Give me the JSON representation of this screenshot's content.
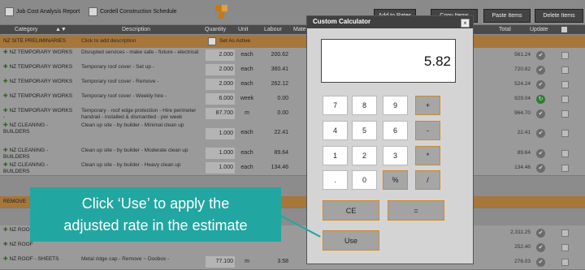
{
  "toolbar": {
    "job_report": "Job Cost Analysis Report",
    "schedule": "Cordell Construction Schedule",
    "btn_add_rates": "Add to Rates",
    "btn_copy_items": "Copy Items",
    "btn_paste_items": "Paste Items",
    "btn_delete_items": "Delete Items"
  },
  "grid": {
    "headers": {
      "category": "Category",
      "description": "Description",
      "quantity": "Quantity",
      "unit": "Unit",
      "labour": "Labour",
      "mate": "Mate",
      "total": "Total",
      "update": "Update"
    },
    "sections": [
      {
        "label": "NZ SITE PRELIMINARIES",
        "note": "Click to add description",
        "flag": "Set As Active"
      },
      {
        "label": "REMOVE"
      }
    ],
    "rows": [
      {
        "category": "NZ TEMPORARY WORKS",
        "description": "Disrupted services - make safe - fixture - electrical",
        "quantity": "2.000",
        "unit": "each",
        "labour": "200.62",
        "total": "561.24",
        "status": "check"
      },
      {
        "category": "NZ TEMPORARY WORKS",
        "description": "Temporary roof cover - Set up -",
        "quantity": "2.000",
        "unit": "each",
        "labour": "360.41",
        "total": "720.82",
        "status": "check"
      },
      {
        "category": "NZ TEMPORARY WORKS",
        "description": "Temporary roof cover - Remove -",
        "quantity": "2.000",
        "unit": "each",
        "labour": "262.12",
        "total": "524.24",
        "status": "check"
      },
      {
        "category": "NZ TEMPORARY WORKS",
        "description": "Temporary roof cover - Weekly hire -",
        "quantity": "6.000",
        "unit": "week",
        "labour": "0.00",
        "total": "929.04",
        "status": "refresh"
      },
      {
        "category": "NZ TEMPORARY WORKS -",
        "description": "Temporary - roof edge protection - Hire perimeter handrail - installed & dismantled - per week",
        "quantity": "87.700",
        "unit": "m",
        "labour": "0.00",
        "total": "964.70",
        "status": "check"
      },
      {
        "category": "NZ CLEANING - BUILDERS",
        "description": "Clean up site - by builder - Minimal clean up",
        "quantity": "1.000",
        "unit": "each",
        "labour": "22.41",
        "total": "22.41",
        "status": "check"
      },
      {
        "category": "NZ CLEANING - BUILDERS",
        "description": "Clean up site - by builder - Moderate clean up",
        "quantity": "1.000",
        "unit": "each",
        "labour": "89.64",
        "total": "89.64",
        "status": "check"
      },
      {
        "category": "NZ CLEANING - BUILDERS",
        "description": "Clean up site - by builder - Heavy clean up",
        "quantity": "1.000",
        "unit": "each",
        "labour": "134.46",
        "total": "134.46",
        "status": "check"
      },
      {
        "category": "NZ ROOF",
        "description": "",
        "quantity": "",
        "unit": "",
        "labour": "",
        "total": "2,311.25",
        "status": "check"
      },
      {
        "category": "NZ ROOF",
        "description": "",
        "quantity": "",
        "unit": "",
        "labour": "",
        "total": "252.40",
        "status": "check"
      },
      {
        "category": "NZ ROOF - SHEETS",
        "description": "Metal ridge cap - Remove ~ Doobox -",
        "quantity": "77.100",
        "unit": "m",
        "labour": "3.58",
        "total": "276.03",
        "status": "check"
      }
    ]
  },
  "calculator": {
    "title": "Custom Calculator",
    "close": "×",
    "display": "5.82",
    "keys": [
      "7",
      "8",
      "9",
      "+",
      "4",
      "5",
      "6",
      "-",
      "1",
      "2",
      "3",
      "*",
      ".",
      "0",
      "%",
      "/"
    ],
    "ce": "CE",
    "equals": "=",
    "use": "Use"
  },
  "callout": {
    "line1": "Click ‘Use’ to apply the",
    "line2": "adjusted rate in the estimate"
  },
  "colors": {
    "callout": "#22a6a1",
    "section": "#a6763a",
    "accent_border": "#c98a34"
  }
}
